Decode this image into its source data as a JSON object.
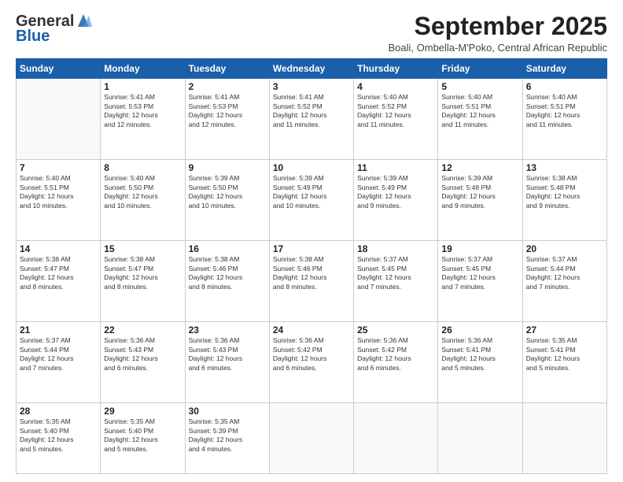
{
  "logo": {
    "general": "General",
    "blue": "Blue",
    "tagline": ""
  },
  "header": {
    "month_title": "September 2025",
    "subtitle": "Boali, Ombella-M'Poko, Central African Republic"
  },
  "weekdays": [
    "Sunday",
    "Monday",
    "Tuesday",
    "Wednesday",
    "Thursday",
    "Friday",
    "Saturday"
  ],
  "weeks": [
    [
      {
        "day": "",
        "info": ""
      },
      {
        "day": "1",
        "info": "Sunrise: 5:41 AM\nSunset: 5:53 PM\nDaylight: 12 hours\nand 12 minutes."
      },
      {
        "day": "2",
        "info": "Sunrise: 5:41 AM\nSunset: 5:53 PM\nDaylight: 12 hours\nand 12 minutes."
      },
      {
        "day": "3",
        "info": "Sunrise: 5:41 AM\nSunset: 5:52 PM\nDaylight: 12 hours\nand 11 minutes."
      },
      {
        "day": "4",
        "info": "Sunrise: 5:40 AM\nSunset: 5:52 PM\nDaylight: 12 hours\nand 11 minutes."
      },
      {
        "day": "5",
        "info": "Sunrise: 5:40 AM\nSunset: 5:51 PM\nDaylight: 12 hours\nand 11 minutes."
      },
      {
        "day": "6",
        "info": "Sunrise: 5:40 AM\nSunset: 5:51 PM\nDaylight: 12 hours\nand 11 minutes."
      }
    ],
    [
      {
        "day": "7",
        "info": "Sunrise: 5:40 AM\nSunset: 5:51 PM\nDaylight: 12 hours\nand 10 minutes."
      },
      {
        "day": "8",
        "info": "Sunrise: 5:40 AM\nSunset: 5:50 PM\nDaylight: 12 hours\nand 10 minutes."
      },
      {
        "day": "9",
        "info": "Sunrise: 5:39 AM\nSunset: 5:50 PM\nDaylight: 12 hours\nand 10 minutes."
      },
      {
        "day": "10",
        "info": "Sunrise: 5:39 AM\nSunset: 5:49 PM\nDaylight: 12 hours\nand 10 minutes."
      },
      {
        "day": "11",
        "info": "Sunrise: 5:39 AM\nSunset: 5:49 PM\nDaylight: 12 hours\nand 9 minutes."
      },
      {
        "day": "12",
        "info": "Sunrise: 5:39 AM\nSunset: 5:48 PM\nDaylight: 12 hours\nand 9 minutes."
      },
      {
        "day": "13",
        "info": "Sunrise: 5:38 AM\nSunset: 5:48 PM\nDaylight: 12 hours\nand 9 minutes."
      }
    ],
    [
      {
        "day": "14",
        "info": "Sunrise: 5:38 AM\nSunset: 5:47 PM\nDaylight: 12 hours\nand 8 minutes."
      },
      {
        "day": "15",
        "info": "Sunrise: 5:38 AM\nSunset: 5:47 PM\nDaylight: 12 hours\nand 8 minutes."
      },
      {
        "day": "16",
        "info": "Sunrise: 5:38 AM\nSunset: 5:46 PM\nDaylight: 12 hours\nand 8 minutes."
      },
      {
        "day": "17",
        "info": "Sunrise: 5:38 AM\nSunset: 5:46 PM\nDaylight: 12 hours\nand 8 minutes."
      },
      {
        "day": "18",
        "info": "Sunrise: 5:37 AM\nSunset: 5:45 PM\nDaylight: 12 hours\nand 7 minutes."
      },
      {
        "day": "19",
        "info": "Sunrise: 5:37 AM\nSunset: 5:45 PM\nDaylight: 12 hours\nand 7 minutes."
      },
      {
        "day": "20",
        "info": "Sunrise: 5:37 AM\nSunset: 5:44 PM\nDaylight: 12 hours\nand 7 minutes."
      }
    ],
    [
      {
        "day": "21",
        "info": "Sunrise: 5:37 AM\nSunset: 5:44 PM\nDaylight: 12 hours\nand 7 minutes."
      },
      {
        "day": "22",
        "info": "Sunrise: 5:36 AM\nSunset: 5:43 PM\nDaylight: 12 hours\nand 6 minutes."
      },
      {
        "day": "23",
        "info": "Sunrise: 5:36 AM\nSunset: 5:43 PM\nDaylight: 12 hours\nand 6 minutes."
      },
      {
        "day": "24",
        "info": "Sunrise: 5:36 AM\nSunset: 5:42 PM\nDaylight: 12 hours\nand 6 minutes."
      },
      {
        "day": "25",
        "info": "Sunrise: 5:36 AM\nSunset: 5:42 PM\nDaylight: 12 hours\nand 6 minutes."
      },
      {
        "day": "26",
        "info": "Sunrise: 5:36 AM\nSunset: 5:41 PM\nDaylight: 12 hours\nand 5 minutes."
      },
      {
        "day": "27",
        "info": "Sunrise: 5:35 AM\nSunset: 5:41 PM\nDaylight: 12 hours\nand 5 minutes."
      }
    ],
    [
      {
        "day": "28",
        "info": "Sunrise: 5:35 AM\nSunset: 5:40 PM\nDaylight: 12 hours\nand 5 minutes."
      },
      {
        "day": "29",
        "info": "Sunrise: 5:35 AM\nSunset: 5:40 PM\nDaylight: 12 hours\nand 5 minutes."
      },
      {
        "day": "30",
        "info": "Sunrise: 5:35 AM\nSunset: 5:39 PM\nDaylight: 12 hours\nand 4 minutes."
      },
      {
        "day": "",
        "info": ""
      },
      {
        "day": "",
        "info": ""
      },
      {
        "day": "",
        "info": ""
      },
      {
        "day": "",
        "info": ""
      }
    ]
  ]
}
